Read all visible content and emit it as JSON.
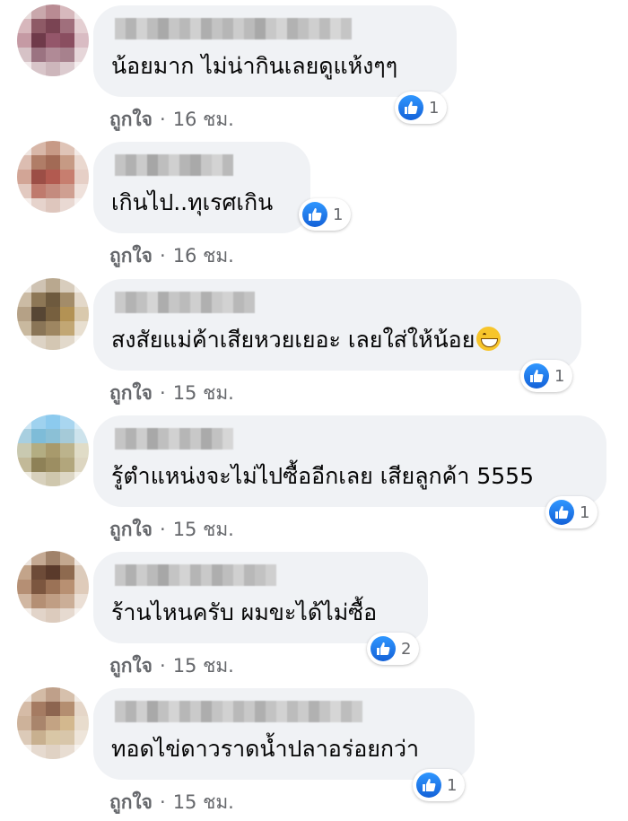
{
  "like_label": "ถูกใจ",
  "separator": "·",
  "comments": [
    {
      "text": "น้อยมาก ไม่น่ากินเลยดูแห้งๆๆ",
      "time": "16 ชม.",
      "likes": "1",
      "emoji": false
    },
    {
      "text": "เกินไป..ทุเรศเกิน",
      "time": "16 ชม.",
      "likes": "1",
      "emoji": false
    },
    {
      "text": "สงสัยแม่ค้าเสียหวยเยอะ เลยใส่ให้น้อย",
      "time": "15 ชม.",
      "likes": "1",
      "emoji": true,
      "emoji_name": "grinning-face-emoji"
    },
    {
      "text": "รู้ตำแหน่งจะไม่ไปซื้ออีกเลย เสียลูกค้า 5555",
      "time": "15 ชม.",
      "likes": "1",
      "emoji": false
    },
    {
      "text": "ร้านไหนครับ ผมขะได้ไม่ซื้อ",
      "time": "15 ชม.",
      "likes": "2",
      "emoji": false
    },
    {
      "text": "ทอดไข่ดาวราดน้ำปลาอร่อยกว่า",
      "time": "15 ชม.",
      "likes": "1",
      "emoji": false
    }
  ],
  "colors": {
    "bubble": "#f0f2f5",
    "text": "#050505",
    "meta": "#65676b",
    "like_blue": "#1877f2"
  },
  "icons": {
    "reaction": "thumbs-up-icon",
    "avatar": "blurred-avatar",
    "name": "blurred-name"
  }
}
